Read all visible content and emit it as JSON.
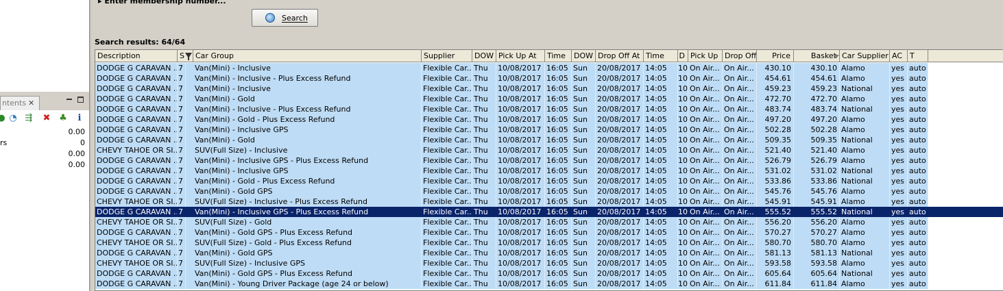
{
  "left_panel": {
    "tab_label": "ntents",
    "tab_close": "✕",
    "toolbar_icons": [
      "sync-icon",
      "clock-icon",
      "export-icon",
      "delete-icon",
      "palm-icon",
      "info-icon"
    ],
    "values": [
      {
        "label": "",
        "value": "0.00"
      },
      {
        "label": "rs",
        "value": "0"
      },
      {
        "label": "",
        "value": "0.00"
      },
      {
        "label": "",
        "value": "0.00"
      }
    ]
  },
  "search": {
    "hint": "Enter membership number...",
    "button_label": "Search"
  },
  "results": {
    "label": "Search results: 64/64"
  },
  "table": {
    "columns": [
      "Description",
      "S",
      "Car Group",
      "Supplier",
      "DOW",
      "Pick Up At",
      "Time",
      "DOW",
      "Drop Off At",
      "Time",
      "D",
      "Pick Up",
      "Drop Off",
      "Price",
      "Basket",
      "Car Supplier",
      "AC",
      "T"
    ],
    "selected_index": 14,
    "rows": [
      [
        "DODGE G CARAVAN ...",
        "7",
        "Van(Mini) - Inclusive",
        "Flexible Car...",
        "Thu",
        "10/08/2017",
        "16:05",
        "Sun",
        "20/08/2017",
        "14:05",
        "10",
        "On Air...",
        "On Air...",
        "430.10",
        "430.10",
        "Alamo",
        "yes",
        "auto"
      ],
      [
        "DODGE G CARAVAN ...",
        "7",
        "Van(Mini) - Inclusive - Plus Excess Refund",
        "Flexible Car...",
        "Thu",
        "10/08/2017",
        "16:05",
        "Sun",
        "20/08/2017",
        "14:05",
        "10",
        "On Air...",
        "On Air...",
        "454.61",
        "454.61",
        "Alamo",
        "yes",
        "auto"
      ],
      [
        "DODGE G CARAVAN ...",
        "7",
        "Van(Mini) - Inclusive",
        "Flexible Car...",
        "Thu",
        "10/08/2017",
        "16:05",
        "Sun",
        "20/08/2017",
        "14:05",
        "10",
        "On Air...",
        "On Air...",
        "459.23",
        "459.23",
        "National",
        "yes",
        "auto"
      ],
      [
        "DODGE G CARAVAN ...",
        "7",
        "Van(Mini) - Gold",
        "Flexible Car...",
        "Thu",
        "10/08/2017",
        "16:05",
        "Sun",
        "20/08/2017",
        "14:05",
        "10",
        "On Air...",
        "On Air...",
        "472.70",
        "472.70",
        "Alamo",
        "yes",
        "auto"
      ],
      [
        "DODGE G CARAVAN ...",
        "7",
        "Van(Mini) - Inclusive - Plus Excess Refund",
        "Flexible Car...",
        "Thu",
        "10/08/2017",
        "16:05",
        "Sun",
        "20/08/2017",
        "14:05",
        "10",
        "On Air...",
        "On Air...",
        "483.74",
        "483.74",
        "National",
        "yes",
        "auto"
      ],
      [
        "DODGE G CARAVAN ...",
        "7",
        "Van(Mini) - Gold - Plus Excess Refund",
        "Flexible Car...",
        "Thu",
        "10/08/2017",
        "16:05",
        "Sun",
        "20/08/2017",
        "14:05",
        "10",
        "On Air...",
        "On Air...",
        "497.20",
        "497.20",
        "Alamo",
        "yes",
        "auto"
      ],
      [
        "DODGE G CARAVAN ...",
        "7",
        "Van(Mini) - Inclusive GPS",
        "Flexible Car...",
        "Thu",
        "10/08/2017",
        "16:05",
        "Sun",
        "20/08/2017",
        "14:05",
        "10",
        "On Air...",
        "On Air...",
        "502.28",
        "502.28",
        "Alamo",
        "yes",
        "auto"
      ],
      [
        "DODGE G CARAVAN ...",
        "7",
        "Van(Mini) - Gold",
        "Flexible Car...",
        "Thu",
        "10/08/2017",
        "16:05",
        "Sun",
        "20/08/2017",
        "14:05",
        "10",
        "On Air...",
        "On Air...",
        "509.35",
        "509.35",
        "National",
        "yes",
        "auto"
      ],
      [
        "CHEVY TAHOE OR SI...",
        "7",
        "SUV(Full Size) - Inclusive",
        "Flexible Car...",
        "Thu",
        "10/08/2017",
        "16:05",
        "Sun",
        "20/08/2017",
        "14:05",
        "10",
        "On Air...",
        "On Air...",
        "521.40",
        "521.40",
        "Alamo",
        "yes",
        "auto"
      ],
      [
        "DODGE G CARAVAN ...",
        "7",
        "Van(Mini) - Inclusive GPS - Plus Excess Refund",
        "Flexible Car...",
        "Thu",
        "10/08/2017",
        "16:05",
        "Sun",
        "20/08/2017",
        "14:05",
        "10",
        "On Air...",
        "On Air...",
        "526.79",
        "526.79",
        "Alamo",
        "yes",
        "auto"
      ],
      [
        "DODGE G CARAVAN ...",
        "7",
        "Van(Mini) - Inclusive GPS",
        "Flexible Car...",
        "Thu",
        "10/08/2017",
        "16:05",
        "Sun",
        "20/08/2017",
        "14:05",
        "10",
        "On Air...",
        "On Air...",
        "531.02",
        "531.02",
        "National",
        "yes",
        "auto"
      ],
      [
        "DODGE G CARAVAN ...",
        "7",
        "Van(Mini) - Gold - Plus Excess Refund",
        "Flexible Car...",
        "Thu",
        "10/08/2017",
        "16:05",
        "Sun",
        "20/08/2017",
        "14:05",
        "10",
        "On Air...",
        "On Air...",
        "533.86",
        "533.86",
        "National",
        "yes",
        "auto"
      ],
      [
        "DODGE G CARAVAN ...",
        "7",
        "Van(Mini) - Gold GPS",
        "Flexible Car...",
        "Thu",
        "10/08/2017",
        "16:05",
        "Sun",
        "20/08/2017",
        "14:05",
        "10",
        "On Air...",
        "On Air...",
        "545.76",
        "545.76",
        "Alamo",
        "yes",
        "auto"
      ],
      [
        "CHEVY TAHOE OR SI...",
        "7",
        "SUV(Full Size) - Inclusive - Plus Excess Refund",
        "Flexible Car...",
        "Thu",
        "10/08/2017",
        "16:05",
        "Sun",
        "20/08/2017",
        "14:05",
        "10",
        "On Air...",
        "On Air...",
        "545.91",
        "545.91",
        "Alamo",
        "yes",
        "auto"
      ],
      [
        "DODGE G CARAVAN ...",
        "7",
        "Van(Mini) - Inclusive GPS - Plus Excess Refund",
        "Flexible Car...",
        "Thu",
        "10/08/2017",
        "16:05",
        "Sun",
        "20/08/2017",
        "14:05",
        "10",
        "On Air...",
        "On Air...",
        "555.52",
        "555.52",
        "National",
        "yes",
        "auto"
      ],
      [
        "CHEVY TAHOE OR SI...",
        "7",
        "SUV(Full Size) - Gold",
        "Flexible Car...",
        "Thu",
        "10/08/2017",
        "16:05",
        "Sun",
        "20/08/2017",
        "14:05",
        "10",
        "On Air...",
        "On Air...",
        "556.20",
        "556.20",
        "Alamo",
        "yes",
        "auto"
      ],
      [
        "DODGE G CARAVAN ...",
        "7",
        "Van(Mini) - Gold GPS - Plus Excess Refund",
        "Flexible Car...",
        "Thu",
        "10/08/2017",
        "16:05",
        "Sun",
        "20/08/2017",
        "14:05",
        "10",
        "On Air...",
        "On Air...",
        "570.27",
        "570.27",
        "Alamo",
        "yes",
        "auto"
      ],
      [
        "CHEVY TAHOE OR SI...",
        "7",
        "SUV(Full Size) - Gold - Plus Excess Refund",
        "Flexible Car...",
        "Thu",
        "10/08/2017",
        "16:05",
        "Sun",
        "20/08/2017",
        "14:05",
        "10",
        "On Air...",
        "On Air...",
        "580.70",
        "580.70",
        "Alamo",
        "yes",
        "auto"
      ],
      [
        "DODGE G CARAVAN ...",
        "7",
        "Van(Mini) - Gold GPS",
        "Flexible Car...",
        "Thu",
        "10/08/2017",
        "16:05",
        "Sun",
        "20/08/2017",
        "14:05",
        "10",
        "On Air...",
        "On Air...",
        "581.13",
        "581.13",
        "National",
        "yes",
        "auto"
      ],
      [
        "CHEVY TAHOE OR SI...",
        "7",
        "SUV(Full Size) - Inclusive GPS",
        "Flexible Car...",
        "Thu",
        "10/08/2017",
        "16:05",
        "Sun",
        "20/08/2017",
        "14:05",
        "10",
        "On Air...",
        "On Air...",
        "593.58",
        "593.58",
        "Alamo",
        "yes",
        "auto"
      ],
      [
        "DODGE G CARAVAN ...",
        "7",
        "Van(Mini) - Gold GPS - Plus Excess Refund",
        "Flexible Car...",
        "Thu",
        "10/08/2017",
        "16:05",
        "Sun",
        "20/08/2017",
        "14:05",
        "10",
        "On Air...",
        "On Air...",
        "605.64",
        "605.64",
        "National",
        "yes",
        "auto"
      ],
      [
        "DODGE G CARAVAN ...",
        "7",
        "Van(Mini) - Young Driver Package (age 24 or below)",
        "Flexible Car...",
        "Thu",
        "10/08/2017",
        "16:05",
        "Sun",
        "20/08/2017",
        "14:05",
        "10",
        "On Air...",
        "On Air...",
        "611.84",
        "611.84",
        "Alamo",
        "yes",
        "auto"
      ]
    ]
  },
  "colors": {
    "row_bg": "#bedcf5",
    "selected_bg": "#0a246a",
    "panel_bg": "#d4d0c8",
    "header_bg": "#ece9d8"
  }
}
